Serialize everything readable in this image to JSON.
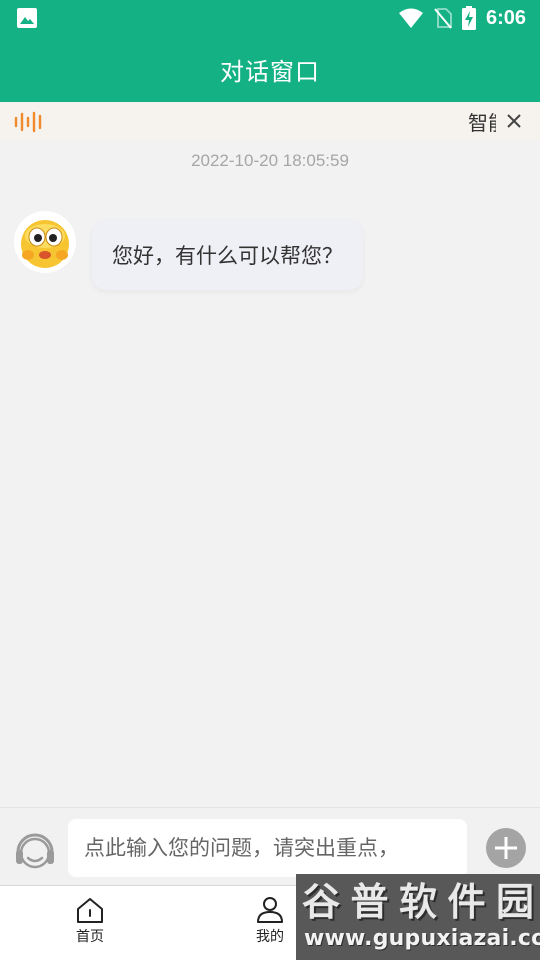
{
  "status_bar": {
    "time": "6:06",
    "icons": [
      "image-icon",
      "wifi-icon",
      "no-sim-icon",
      "battery-charging-icon"
    ]
  },
  "header": {
    "title": "对话窗口"
  },
  "notice": {
    "icon": "sound-wave-icon",
    "text": "智能客服",
    "close_icon": "close-icon"
  },
  "chat": {
    "timestamp": "2022-10-20 18:05:59",
    "messages": [
      {
        "sender": "bot",
        "avatar": "emoji-avatar",
        "text": "您好，有什么可以帮您？"
      }
    ]
  },
  "composer": {
    "voice_icon": "headset-icon",
    "placeholder": "点此输入您的问题，请突出重点，",
    "value": "",
    "plus_icon": "plus-icon"
  },
  "nav": {
    "items": [
      {
        "label": "首页",
        "icon": "home-icon"
      },
      {
        "label": "我的",
        "icon": "user-icon"
      }
    ]
  },
  "watermark": {
    "chars": [
      "谷",
      "普",
      "软",
      "件",
      "园"
    ],
    "url": "www.gupuxiazai.com"
  },
  "colors": {
    "primary": "#13b183",
    "background": "#f2f2f2",
    "bubble": "#efeff6",
    "notice_bg": "#f6f2ee",
    "notice_icon": "#f08a2c"
  }
}
